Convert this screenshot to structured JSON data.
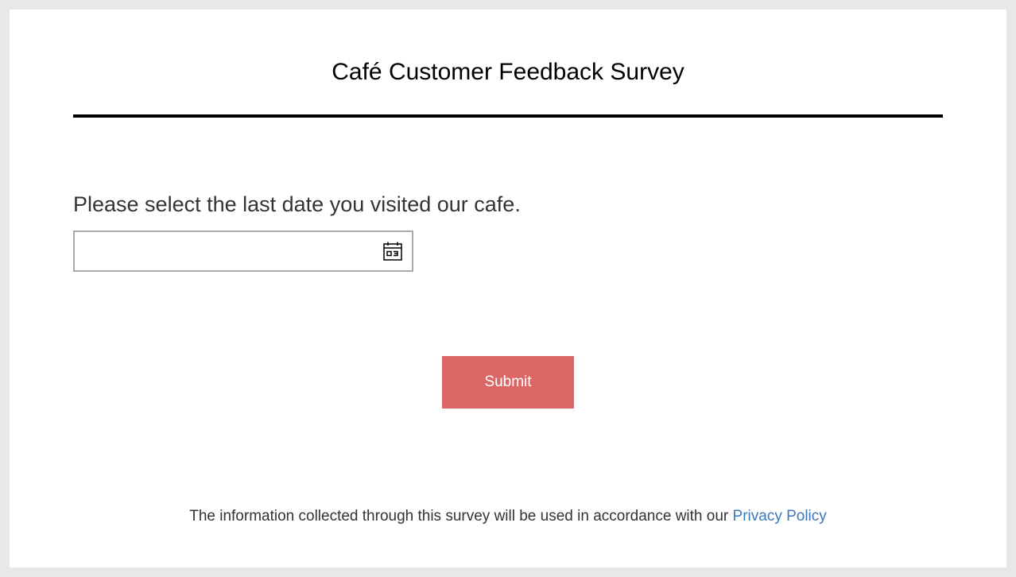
{
  "survey": {
    "title": "Café Customer Feedback Survey"
  },
  "question": {
    "label": "Please select the last date you visited our cafe.",
    "date_value": "",
    "icon": "calendar-icon"
  },
  "actions": {
    "submit_label": "Submit"
  },
  "footer": {
    "text": "The information collected through this survey will be used in accordance with our",
    "link_label": "Privacy Policy"
  },
  "colors": {
    "submit_bg": "#dc6666",
    "link": "#3d78b8",
    "page_bg": "#e8e8e8"
  }
}
